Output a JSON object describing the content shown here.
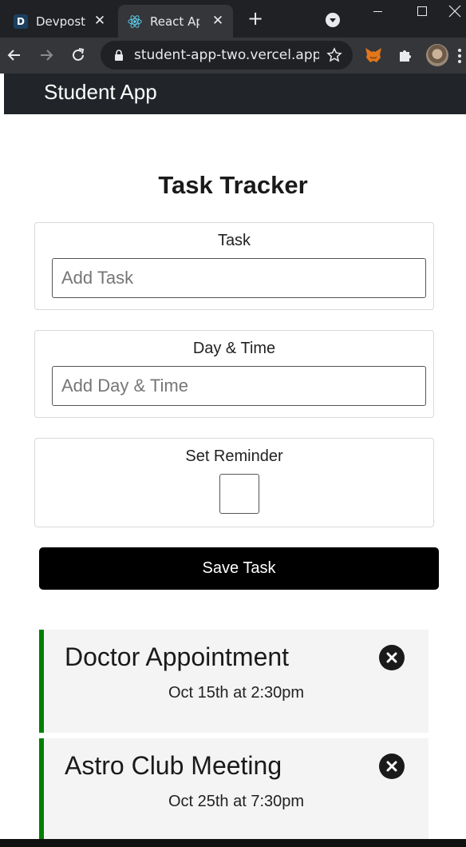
{
  "browser": {
    "tabs": [
      {
        "label": "Devpost",
        "favicon": "D"
      },
      {
        "label": "React App"
      }
    ],
    "address": "student-app-two.vercel.app..."
  },
  "app": {
    "brand": "Student App",
    "title": "Task Tracker",
    "form": {
      "task_label": "Task",
      "task_placeholder": "Add Task",
      "day_label": "Day & Time",
      "day_placeholder": "Add Day & Time",
      "reminder_label": "Set Reminder",
      "reminder_checked": false,
      "save_label": "Save Task"
    },
    "tasks": [
      {
        "title": "Doctor Appointment",
        "day": "Oct 15th at 2:30pm",
        "reminder": true
      },
      {
        "title": "Astro Club Meeting",
        "day": "Oct 25th at 7:30pm",
        "reminder": true
      }
    ],
    "colors": {
      "navbar": "#212529",
      "reminder_border": "#008000",
      "button": "#000000",
      "task_bg": "#f4f4f4"
    }
  }
}
